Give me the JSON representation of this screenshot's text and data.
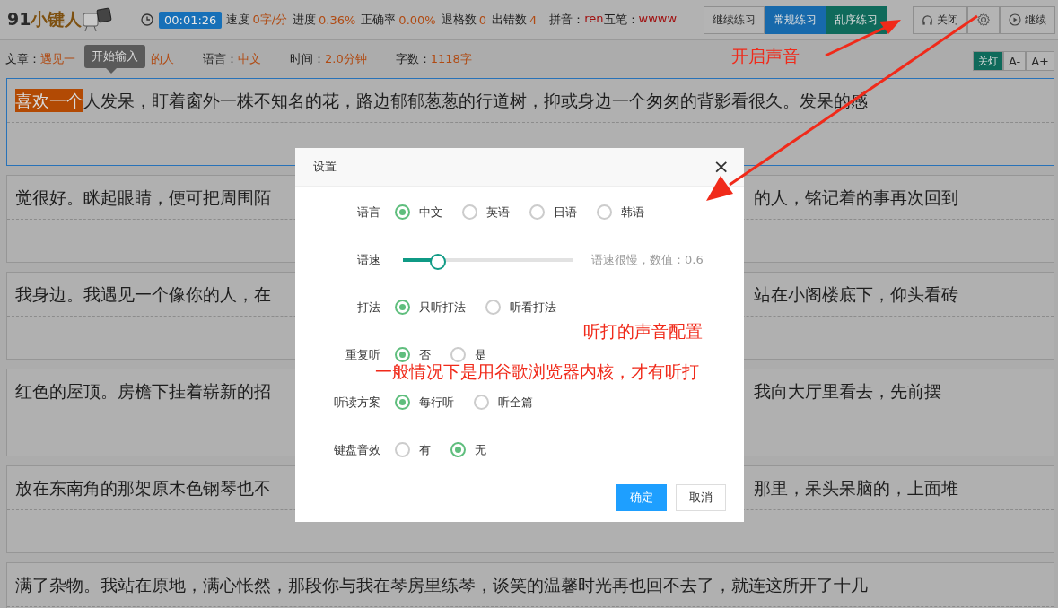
{
  "logo": {
    "prefix": "91",
    "name": "小键人"
  },
  "timer": "00:01:26",
  "stats": [
    {
      "label": "速度",
      "value": "0字/分"
    },
    {
      "label": "进度",
      "value": "0.36%"
    },
    {
      "label": "正确率",
      "value": "0.00%"
    },
    {
      "label": "退格数",
      "value": "0"
    },
    {
      "label": "出错数",
      "value": "4"
    }
  ],
  "codes": [
    {
      "label": "拼音：",
      "value": "ren"
    },
    {
      "label": "五笔：",
      "value": "wwww"
    }
  ],
  "modes": [
    {
      "label": "继续练习",
      "kind": "plain"
    },
    {
      "label": "常规练习",
      "kind": "primary"
    },
    {
      "label": "乱序练习",
      "kind": "success"
    }
  ],
  "tools": [
    {
      "label": "关闭",
      "kind": "headphones"
    },
    {
      "kind": "gear"
    },
    {
      "label": "继续",
      "kind": "play"
    }
  ],
  "info": [
    {
      "label": "文章：",
      "value": "遇见一",
      "value_right": "的人"
    },
    {
      "label": "语言：",
      "value": "中文"
    },
    {
      "label": "时间：",
      "value": "2.0分钟"
    },
    {
      "label": "字数：",
      "value": "1118字"
    }
  ],
  "tooltip": "开始输入",
  "view_buttons": [
    {
      "label": "关灯",
      "kind": "success"
    },
    {
      "label": "A-",
      "kind": "plain"
    },
    {
      "label": "A+",
      "kind": "plain"
    }
  ],
  "lines": [
    {
      "typed": "喜欢一个",
      "text": "人发呆，盯着窗外一株不知名的花，路边郁郁葱葱的行道树，抑或身边一个匆匆的背影看很久。发呆的感",
      "active": true
    },
    {
      "text": "觉很好。眯起眼睛，便可把周围陌",
      "text_right": "的人，铭记着的事再次回到",
      "active": false
    },
    {
      "text": "我身边。我遇见一个像你的人，在",
      "text_right": "站在小阁楼底下，仰头看砖",
      "active": false
    },
    {
      "text": "红色的屋顶。房檐下挂着崭新的招",
      "text_right": "我向大厅里看去，先前摆",
      "active": false
    },
    {
      "text": "放在东南角的那架原木色钢琴也不",
      "text_right": "那里，呆头呆脑的，上面堆",
      "active": false
    },
    {
      "text": "满了杂物。我站在原地，满心怅然，那段你与我在琴房里练琴，谈笑的温馨时光再也回不去了，就连这所开了十几",
      "active": false
    }
  ],
  "dialog": {
    "title": "设置",
    "close": "×",
    "settings": [
      {
        "label": "语言",
        "kind": "radio",
        "options": [
          {
            "label": "中文",
            "selected": true
          },
          {
            "label": "英语",
            "selected": false
          },
          {
            "label": "日语",
            "selected": false
          },
          {
            "label": "韩语",
            "selected": false
          }
        ]
      },
      {
        "label": "语速",
        "kind": "slider",
        "level": 0.2,
        "reading": "语速很慢，数值：0.6"
      },
      {
        "label": "打法",
        "kind": "radio",
        "options": [
          {
            "label": "只听打法",
            "selected": true
          },
          {
            "label": "听看打法",
            "selected": false
          }
        ]
      },
      {
        "label": "重复听",
        "kind": "radio",
        "options": [
          {
            "label": "否",
            "selected": true
          },
          {
            "label": "是",
            "selected": false
          }
        ]
      },
      {
        "label": "听读方案",
        "kind": "radio",
        "options": [
          {
            "label": "每行听",
            "selected": true
          },
          {
            "label": "听全篇",
            "selected": false
          }
        ]
      },
      {
        "label": "键盘音效",
        "kind": "radio",
        "options": [
          {
            "label": "有",
            "selected": false
          },
          {
            "label": "无",
            "selected": true
          }
        ]
      }
    ],
    "buttons": [
      {
        "label": "确定",
        "kind": "primary"
      },
      {
        "label": "取消",
        "kind": "plain"
      }
    ]
  },
  "annotations": [
    {
      "text": "开启声音",
      "kind": "sound"
    },
    {
      "text": "听打的声音配置",
      "kind": "config"
    },
    {
      "text": "一般情况下是用谷歌浏览器内核，才有听打",
      "kind": "note"
    }
  ]
}
